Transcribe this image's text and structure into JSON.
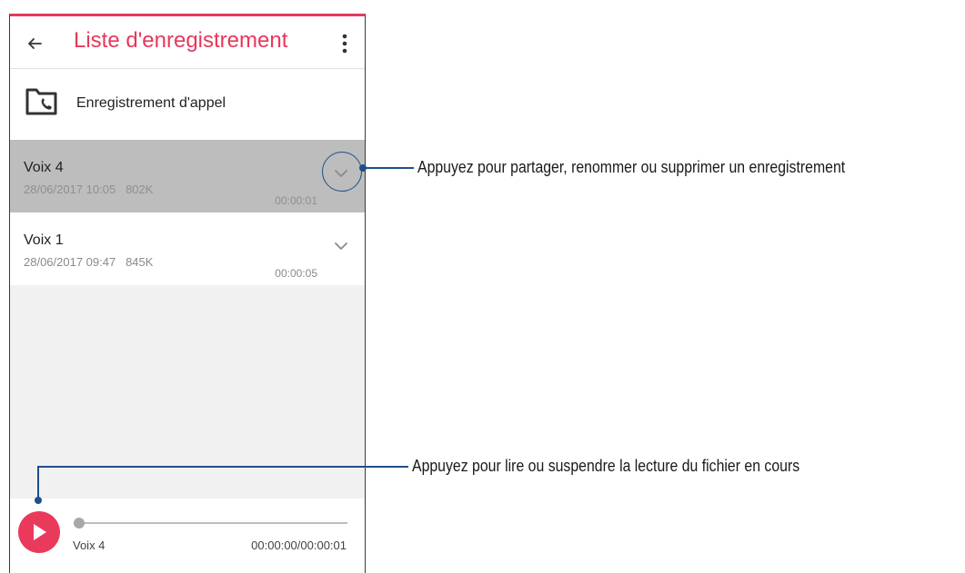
{
  "app": {
    "title": "Liste d'enregistrement"
  },
  "call_recording": {
    "label": "Enregistrement d'appel"
  },
  "recordings": [
    {
      "name": "Voix 4",
      "date": "28/06/2017 10:05",
      "size": "802K",
      "duration": "00:00:01",
      "selected": true
    },
    {
      "name": "Voix 1",
      "date": "28/06/2017 09:47",
      "size": "845K",
      "duration": "00:00:05",
      "selected": false
    }
  ],
  "player": {
    "track_name": "Voix 4",
    "time": "00:00:00/00:00:01",
    "progress": 0
  },
  "annotations": {
    "menu_callout": "Appuyez pour partager, renommer ou supprimer un enregistrement",
    "play_callout": "Appuyez pour lire ou suspendre la lecture du fichier en cours"
  },
  "colors": {
    "accent": "#e8375a",
    "callout": "#1f4f8a",
    "selected_row": "#bdbdbd"
  },
  "icons": {
    "back": "arrow-left-icon",
    "more": "more-vert-icon",
    "call_folder": "call-recording-folder-icon",
    "expand": "chevron-down-icon",
    "play": "play-icon"
  }
}
